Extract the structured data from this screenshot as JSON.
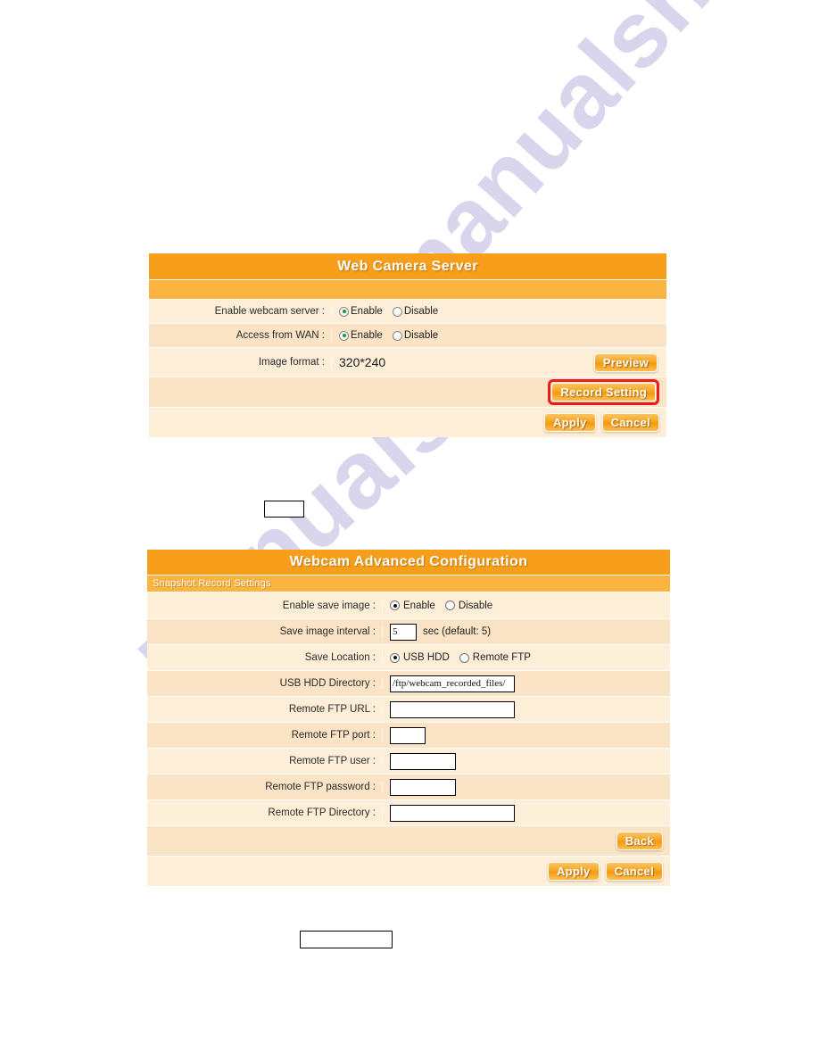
{
  "watermark": {
    "line1": "manualshive.com",
    "line2": "manualshive",
    "color": "#b9b4e0"
  },
  "theme": {
    "title_bar": "#F79F1B",
    "sub_bar": "#FBB440",
    "row_light": "#FDEED8",
    "row_alt": "#FBE4C5",
    "button_orange": "#F7A824",
    "highlight_red": "#EC1C1C"
  },
  "panel1": {
    "title": "Web Camera Server",
    "rows": [
      {
        "label": "Enable webcam server :",
        "type": "radio",
        "options": [
          "Enable",
          "Disable"
        ],
        "selected": "Enable"
      },
      {
        "label": "Access from WAN :",
        "type": "radio",
        "options": [
          "Enable",
          "Disable"
        ],
        "selected": "Enable"
      },
      {
        "label": "Image format :",
        "type": "text-with-button",
        "value": "320*240",
        "button": "Preview"
      }
    ],
    "record_setting_button": "Record Setting",
    "apply_button": "Apply",
    "cancel_button": "Cancel"
  },
  "panel2": {
    "title": "Webcam Advanced Configuration",
    "section_label": "Snapshot Record Settings",
    "rows": [
      {
        "label": "Enable save image :",
        "type": "radio",
        "options": [
          "Enable",
          "Disable"
        ],
        "selected": "Enable"
      },
      {
        "label": "Save image interval :",
        "type": "input",
        "value": "5",
        "hint": "sec (default: 5)"
      },
      {
        "label": "Save Location :",
        "type": "radio",
        "options": [
          "USB HDD",
          "Remote FTP"
        ],
        "selected": "USB HDD"
      },
      {
        "label": "USB HDD Directory :",
        "type": "input",
        "value": "/ftp/webcam_recorded_files/",
        "hint": ""
      },
      {
        "label": "Remote FTP URL :",
        "type": "input",
        "value": "",
        "hint": ""
      },
      {
        "label": "Remote FTP port :",
        "type": "input",
        "value": "",
        "hint": ""
      },
      {
        "label": "Remote FTP user :",
        "type": "input",
        "value": "",
        "hint": ""
      },
      {
        "label": "Remote FTP password :",
        "type": "input",
        "value": "",
        "hint": ""
      },
      {
        "label": "Remote FTP Directory :",
        "type": "input",
        "value": "",
        "hint": ""
      }
    ],
    "back_button": "Back",
    "apply_button": "Apply",
    "cancel_button": "Cancel"
  },
  "callouts": {
    "box1": "",
    "box2": ""
  }
}
